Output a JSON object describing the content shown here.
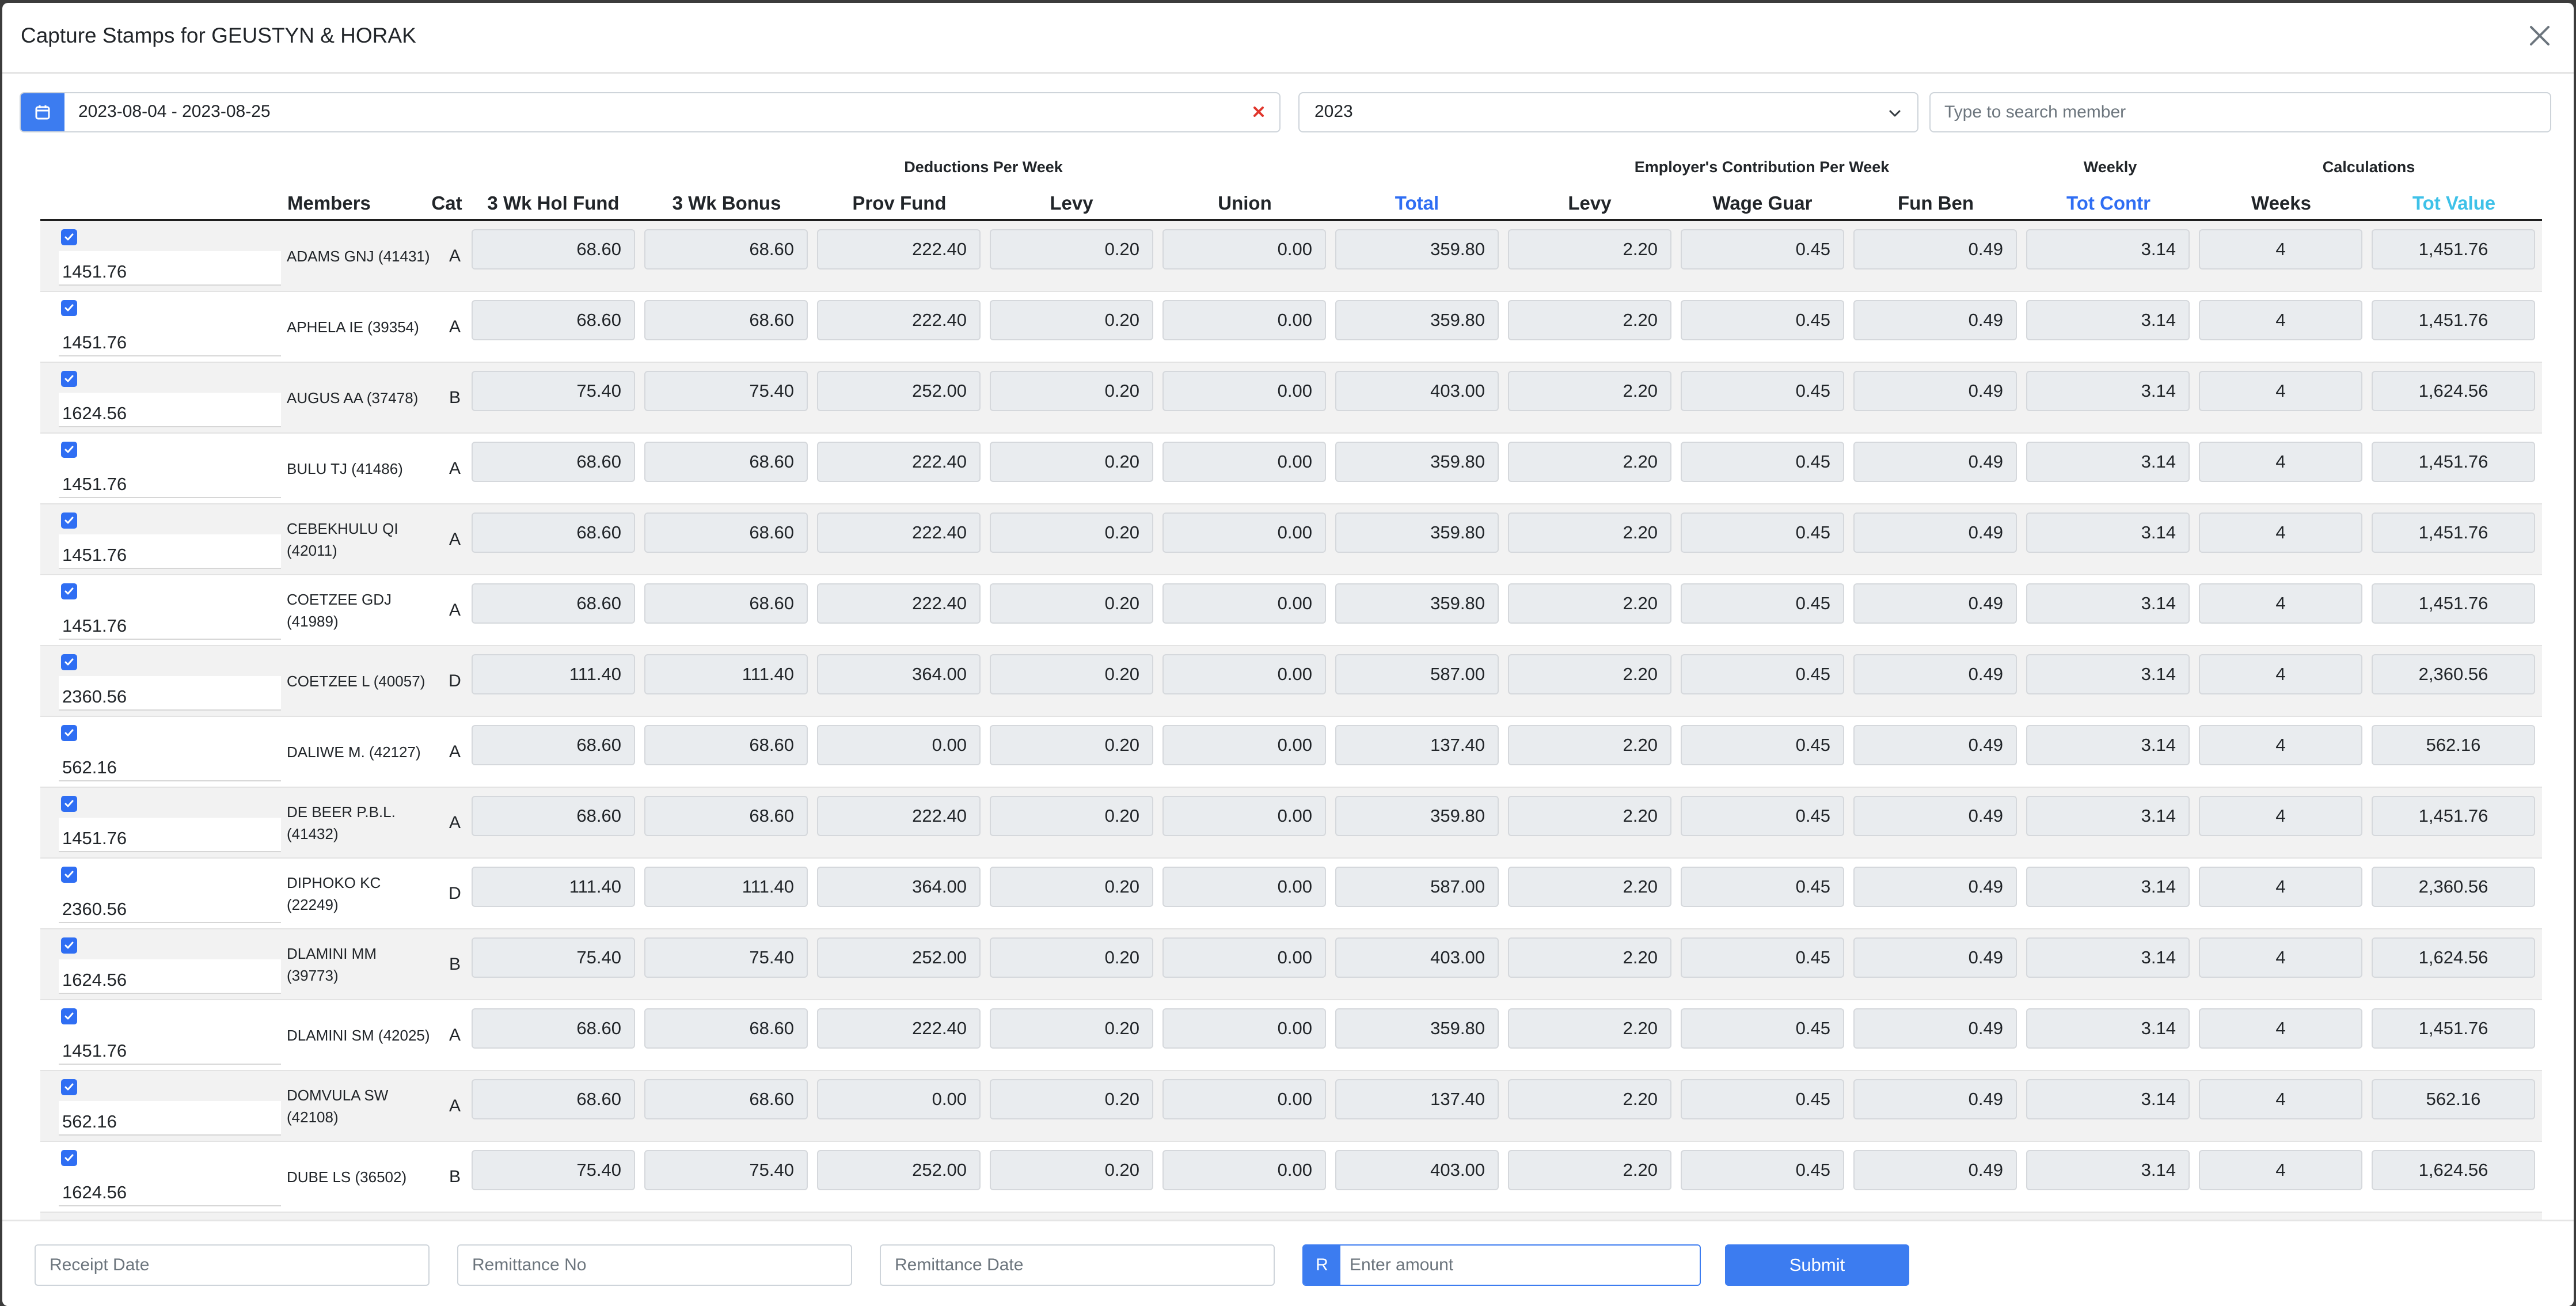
{
  "modal": {
    "title": "Capture Stamps for GEUSTYN & HORAK"
  },
  "filters": {
    "date_range": "2023-08-04 - 2023-08-25",
    "year": "2023",
    "search_placeholder": "Type to search member"
  },
  "table": {
    "groups": {
      "deductions": "Deductions Per Week",
      "employer": "Employer's Contribution Per Week",
      "weekly": "Weekly",
      "calculations": "Calculations"
    },
    "columns": {
      "members": "Members",
      "cat": "Cat",
      "hol_fund": "3 Wk Hol Fund",
      "bonus": "3 Wk Bonus",
      "prov_fund": "Prov Fund",
      "levy": "Levy",
      "union": "Union",
      "total": "Total",
      "emp_levy": "Levy",
      "wage_guar": "Wage Guar",
      "fun_ben": "Fun Ben",
      "tot_contr": "Tot Contr",
      "weeks": "Weeks",
      "tot_value": "Tot Value"
    },
    "rows": [
      {
        "amount": "1451.76",
        "name": "ADAMS GNJ (41431)",
        "cat": "A",
        "hol": "68.60",
        "bonus": "68.60",
        "prov": "222.40",
        "levy": "0.20",
        "union": "0.00",
        "total": "359.80",
        "elevy": "2.20",
        "wage": "0.45",
        "fun": "0.49",
        "contr": "3.14",
        "weeks": "4",
        "value": "1,451.76"
      },
      {
        "amount": "1451.76",
        "name": "APHELA IE (39354)",
        "cat": "A",
        "hol": "68.60",
        "bonus": "68.60",
        "prov": "222.40",
        "levy": "0.20",
        "union": "0.00",
        "total": "359.80",
        "elevy": "2.20",
        "wage": "0.45",
        "fun": "0.49",
        "contr": "3.14",
        "weeks": "4",
        "value": "1,451.76"
      },
      {
        "amount": "1624.56",
        "name": "AUGUS AA (37478)",
        "cat": "B",
        "hol": "75.40",
        "bonus": "75.40",
        "prov": "252.00",
        "levy": "0.20",
        "union": "0.00",
        "total": "403.00",
        "elevy": "2.20",
        "wage": "0.45",
        "fun": "0.49",
        "contr": "3.14",
        "weeks": "4",
        "value": "1,624.56"
      },
      {
        "amount": "1451.76",
        "name": "BULU TJ (41486)",
        "cat": "A",
        "hol": "68.60",
        "bonus": "68.60",
        "prov": "222.40",
        "levy": "0.20",
        "union": "0.00",
        "total": "359.80",
        "elevy": "2.20",
        "wage": "0.45",
        "fun": "0.49",
        "contr": "3.14",
        "weeks": "4",
        "value": "1,451.76"
      },
      {
        "amount": "1451.76",
        "name": "CEBEKHULU QI (42011)",
        "cat": "A",
        "hol": "68.60",
        "bonus": "68.60",
        "prov": "222.40",
        "levy": "0.20",
        "union": "0.00",
        "total": "359.80",
        "elevy": "2.20",
        "wage": "0.45",
        "fun": "0.49",
        "contr": "3.14",
        "weeks": "4",
        "value": "1,451.76"
      },
      {
        "amount": "1451.76",
        "name": "COETZEE GDJ (41989)",
        "cat": "A",
        "hol": "68.60",
        "bonus": "68.60",
        "prov": "222.40",
        "levy": "0.20",
        "union": "0.00",
        "total": "359.80",
        "elevy": "2.20",
        "wage": "0.45",
        "fun": "0.49",
        "contr": "3.14",
        "weeks": "4",
        "value": "1,451.76"
      },
      {
        "amount": "2360.56",
        "name": "COETZEE L (40057)",
        "cat": "D",
        "hol": "111.40",
        "bonus": "111.40",
        "prov": "364.00",
        "levy": "0.20",
        "union": "0.00",
        "total": "587.00",
        "elevy": "2.20",
        "wage": "0.45",
        "fun": "0.49",
        "contr": "3.14",
        "weeks": "4",
        "value": "2,360.56"
      },
      {
        "amount": "562.16",
        "name": "DALIWE M. (42127)",
        "cat": "A",
        "hol": "68.60",
        "bonus": "68.60",
        "prov": "0.00",
        "levy": "0.20",
        "union": "0.00",
        "total": "137.40",
        "elevy": "2.20",
        "wage": "0.45",
        "fun": "0.49",
        "contr": "3.14",
        "weeks": "4",
        "value": "562.16"
      },
      {
        "amount": "1451.76",
        "name": "DE BEER P.B.L. (41432)",
        "cat": "A",
        "hol": "68.60",
        "bonus": "68.60",
        "prov": "222.40",
        "levy": "0.20",
        "union": "0.00",
        "total": "359.80",
        "elevy": "2.20",
        "wage": "0.45",
        "fun": "0.49",
        "contr": "3.14",
        "weeks": "4",
        "value": "1,451.76"
      },
      {
        "amount": "2360.56",
        "name": "DIPHOKO KC (22249)",
        "cat": "D",
        "hol": "111.40",
        "bonus": "111.40",
        "prov": "364.00",
        "levy": "0.20",
        "union": "0.00",
        "total": "587.00",
        "elevy": "2.20",
        "wage": "0.45",
        "fun": "0.49",
        "contr": "3.14",
        "weeks": "4",
        "value": "2,360.56"
      },
      {
        "amount": "1624.56",
        "name": "DLAMINI MM (39773)",
        "cat": "B",
        "hol": "75.40",
        "bonus": "75.40",
        "prov": "252.00",
        "levy": "0.20",
        "union": "0.00",
        "total": "403.00",
        "elevy": "2.20",
        "wage": "0.45",
        "fun": "0.49",
        "contr": "3.14",
        "weeks": "4",
        "value": "1,624.56"
      },
      {
        "amount": "1451.76",
        "name": "DLAMINI SM (42025)",
        "cat": "A",
        "hol": "68.60",
        "bonus": "68.60",
        "prov": "222.40",
        "levy": "0.20",
        "union": "0.00",
        "total": "359.80",
        "elevy": "2.20",
        "wage": "0.45",
        "fun": "0.49",
        "contr": "3.14",
        "weeks": "4",
        "value": "1,451.76"
      },
      {
        "amount": "562.16",
        "name": "DOMVULA SW (42108)",
        "cat": "A",
        "hol": "68.60",
        "bonus": "68.60",
        "prov": "0.00",
        "levy": "0.20",
        "union": "0.00",
        "total": "137.40",
        "elevy": "2.20",
        "wage": "0.45",
        "fun": "0.49",
        "contr": "3.14",
        "weeks": "4",
        "value": "562.16"
      },
      {
        "amount": "1624.56",
        "name": "DUBE LS (36502)",
        "cat": "B",
        "hol": "75.40",
        "bonus": "75.40",
        "prov": "252.00",
        "levy": "0.20",
        "union": "0.00",
        "total": "403.00",
        "elevy": "2.20",
        "wage": "0.45",
        "fun": "0.49",
        "contr": "3.14",
        "weeks": "4",
        "value": "1,624.56"
      }
    ]
  },
  "footer": {
    "receipt_date_placeholder": "Receipt Date",
    "remittance_no_placeholder": "Remittance No",
    "remittance_date_placeholder": "Remittance Date",
    "currency_prefix": "R",
    "amount_placeholder": "Enter amount",
    "submit_label": "Submit"
  },
  "colors": {
    "accent": "#3c7cf0",
    "total_header": "#2f6ef3",
    "tot_value_header": "#3ec1e8"
  },
  "icons": {
    "date": "calendar-icon",
    "clear": "clear-x-icon",
    "close": "close-icon",
    "year": "chevron-down-icon",
    "row_check": "checkbox-checked-icon"
  }
}
